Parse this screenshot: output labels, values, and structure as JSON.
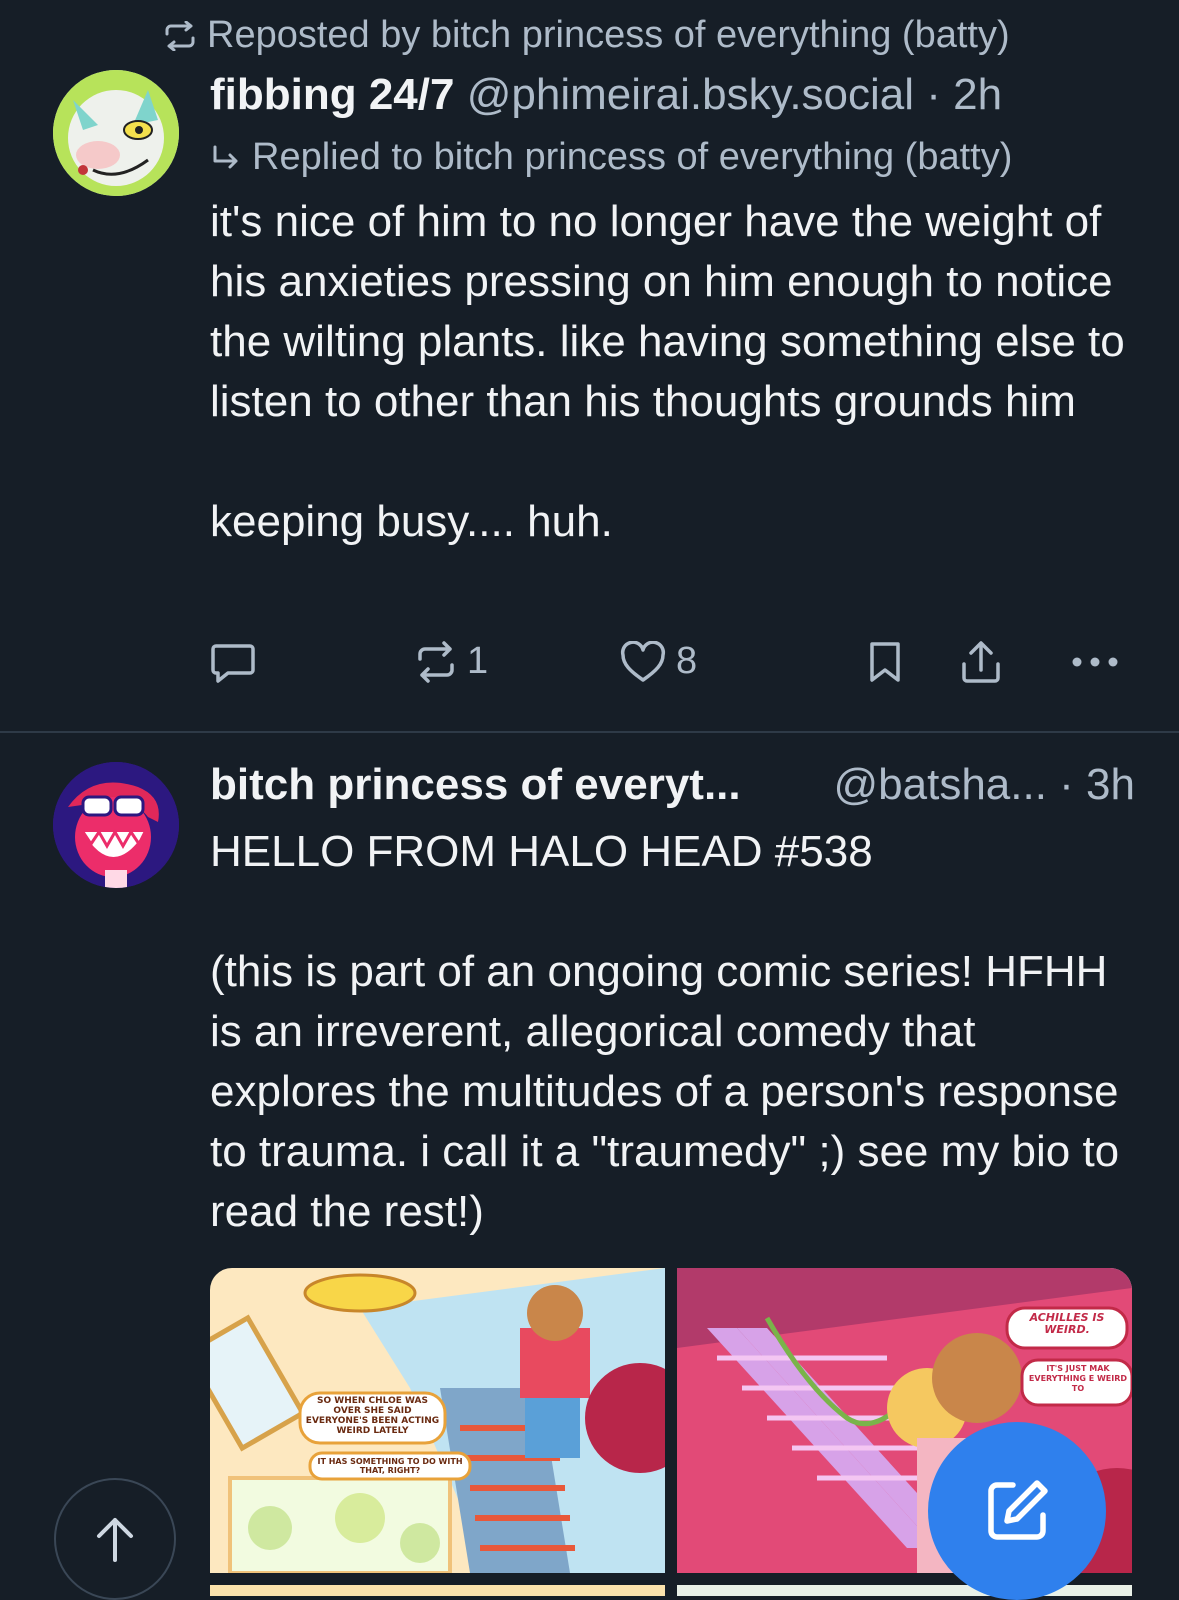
{
  "colors": {
    "background": "#161e27",
    "accent": "#2f80ed",
    "muted": "#aebbc9",
    "text": "#f1f3f5",
    "divider": "#2e3a47"
  },
  "post1": {
    "repost_text": "Reposted by bitch princess of everything (batty)",
    "author_name": "fibbing 24/7",
    "handle": "@phimeirai.bsky.social",
    "time": "· 2h",
    "reply_text": "Replied to bitch princess of everything (batty)",
    "body": "it's nice of him to no longer have the weight of his anxieties pressing on him enough to notice the wilting plants. like having something else to listen to other than his thoughts grounds him\n\nkeeping busy.... huh.",
    "reposts": "1",
    "likes": "8"
  },
  "post2": {
    "author_name": "bitch princess of everyt...",
    "handle": "@batsha...",
    "time": "· 3h",
    "body": "HELLO FROM HALO HEAD #538\n\n(this is part of an ongoing comic series! HFHH is an irreverent, allegorical comedy that explores the multitudes of a person's response to trauma. i call it a \"traumedy\" ;) see my bio to read the rest!)",
    "comic_left": {
      "bubble1": "SO WHEN CHLOE WAS OVER SHE SAID EVERYONE'S BEEN ACTING WEIRD LATELY",
      "bubble2": "IT HAS SOMETHING TO DO WITH THAT, RIGHT?"
    },
    "comic_right": {
      "bubble1": "ACHILLES IS WEIRD.",
      "bubble2": "IT'S JUST MAK EVERYTHING E WEIRD TO"
    }
  },
  "icons": [
    "repost-icon",
    "reply-arrow-icon",
    "comment-icon",
    "like-icon",
    "bookmark-icon",
    "share-icon",
    "more-icon",
    "scroll-top-icon",
    "compose-icon"
  ]
}
